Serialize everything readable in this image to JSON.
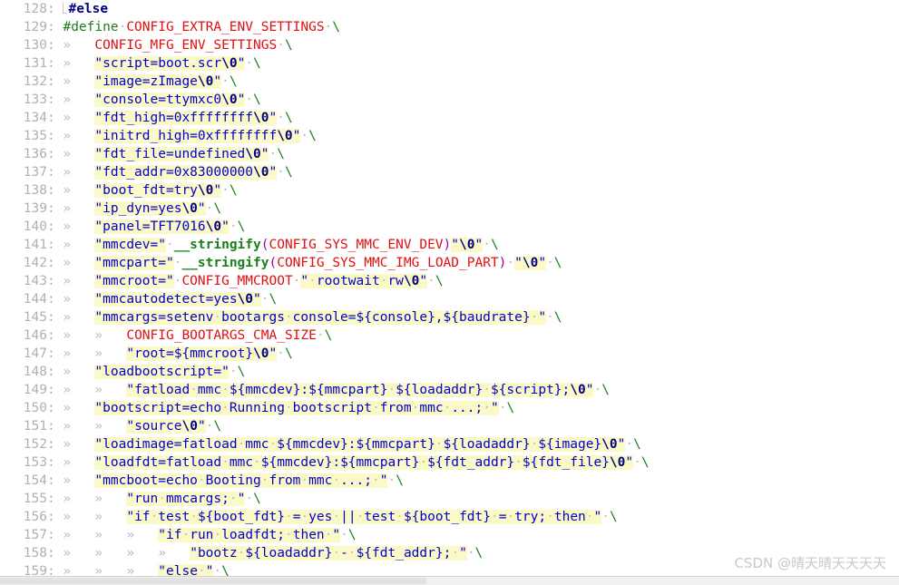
{
  "editor": {
    "kind": "source-code-viewer",
    "language": "C header",
    "first_line": 128,
    "last_line": 159,
    "line_height_px": 20,
    "colors": {
      "background": "#ffffff",
      "gutter_text": "#b0b0b0",
      "string_highlight": "#fbf9c8",
      "string_text": "#0000cc",
      "macro_red": "#e01010",
      "preprocessor_green": "#1a7f1a",
      "keyword_navy": "#000080",
      "paren_purple": "#a000a0",
      "tab_marker": "#bdbdbd",
      "space_dot": "#bbbbbb",
      "watermark": "#c9c9c9",
      "scrollbar_track": "#f0f0f0",
      "scrollbar_thumb": "#e2e2e2"
    },
    "markers": {
      "tab": "»",
      "space": "·",
      "continuation": "\\"
    }
  },
  "watermark": {
    "text": "CSDN @晴天晴天天天天"
  },
  "lines": [
    {
      "n": "128",
      "text": "#else"
    },
    {
      "n": "129",
      "text": "#define CONFIG_EXTRA_ENV_SETTINGS \\"
    },
    {
      "n": "130",
      "text": "\tCONFIG_MFG_ENV_SETTINGS \\"
    },
    {
      "n": "131",
      "text": "\t\"script=boot.scr\\0\" \\"
    },
    {
      "n": "132",
      "text": "\t\"image=zImage\\0\" \\"
    },
    {
      "n": "133",
      "text": "\t\"console=ttymxc0\\0\" \\"
    },
    {
      "n": "134",
      "text": "\t\"fdt_high=0xffffffff\\0\" \\"
    },
    {
      "n": "135",
      "text": "\t\"initrd_high=0xffffffff\\0\" \\"
    },
    {
      "n": "136",
      "text": "\t\"fdt_file=undefined\\0\" \\"
    },
    {
      "n": "137",
      "text": "\t\"fdt_addr=0x83000000\\0\" \\"
    },
    {
      "n": "138",
      "text": "\t\"boot_fdt=try\\0\" \\"
    },
    {
      "n": "139",
      "text": "\t\"ip_dyn=yes\\0\" \\"
    },
    {
      "n": "140",
      "text": "\t\"panel=TFT7016\\0\" \\"
    },
    {
      "n": "141",
      "text": "\t\"mmcdev=\" __stringify(CONFIG_SYS_MMC_ENV_DEV)\"\\0\" \\"
    },
    {
      "n": "142",
      "text": "\t\"mmcpart=\" __stringify(CONFIG_SYS_MMC_IMG_LOAD_PART) \"\\0\" \\"
    },
    {
      "n": "143",
      "text": "\t\"mmcroot=\" CONFIG_MMCROOT \" rootwait rw\\0\" \\"
    },
    {
      "n": "144",
      "text": "\t\"mmcautodetect=yes\\0\" \\"
    },
    {
      "n": "145",
      "text": "\t\"mmcargs=setenv bootargs console=${console},${baudrate} \" \\"
    },
    {
      "n": "146",
      "text": "\t\tCONFIG_BOOTARGS_CMA_SIZE \\"
    },
    {
      "n": "147",
      "text": "\t\t\"root=${mmcroot}\\0\" \\"
    },
    {
      "n": "148",
      "text": "\t\"loadbootscript=\" \\"
    },
    {
      "n": "149",
      "text": "\t\t\"fatload mmc ${mmcdev}:${mmcpart} ${loadaddr} ${script};\\0\" \\"
    },
    {
      "n": "150",
      "text": "\t\"bootscript=echo Running bootscript from mmc ...; \" \\"
    },
    {
      "n": "151",
      "text": "\t\t\"source\\0\" \\"
    },
    {
      "n": "152",
      "text": "\t\"loadimage=fatload mmc ${mmcdev}:${mmcpart} ${loadaddr} ${image}\\0\" \\"
    },
    {
      "n": "153",
      "text": "\t\"loadfdt=fatload mmc ${mmcdev}:${mmcpart} ${fdt_addr} ${fdt_file}\\0\" \\"
    },
    {
      "n": "154",
      "text": "\t\"mmcboot=echo Booting from mmc ...; \" \\"
    },
    {
      "n": "155",
      "text": "\t\t\"run mmcargs; \" \\"
    },
    {
      "n": "156",
      "text": "\t\t\"if test ${boot_fdt} = yes || test ${boot_fdt} = try; then \" \\"
    },
    {
      "n": "157",
      "text": "\t\t\t\"if run loadfdt; then \" \\"
    },
    {
      "n": "158",
      "text": "\t\t\t\t\"bootz ${loadaddr} - ${fdt_addr}; \" \\"
    },
    {
      "n": "159",
      "text": "\t\t\t\"else \" \\"
    }
  ]
}
